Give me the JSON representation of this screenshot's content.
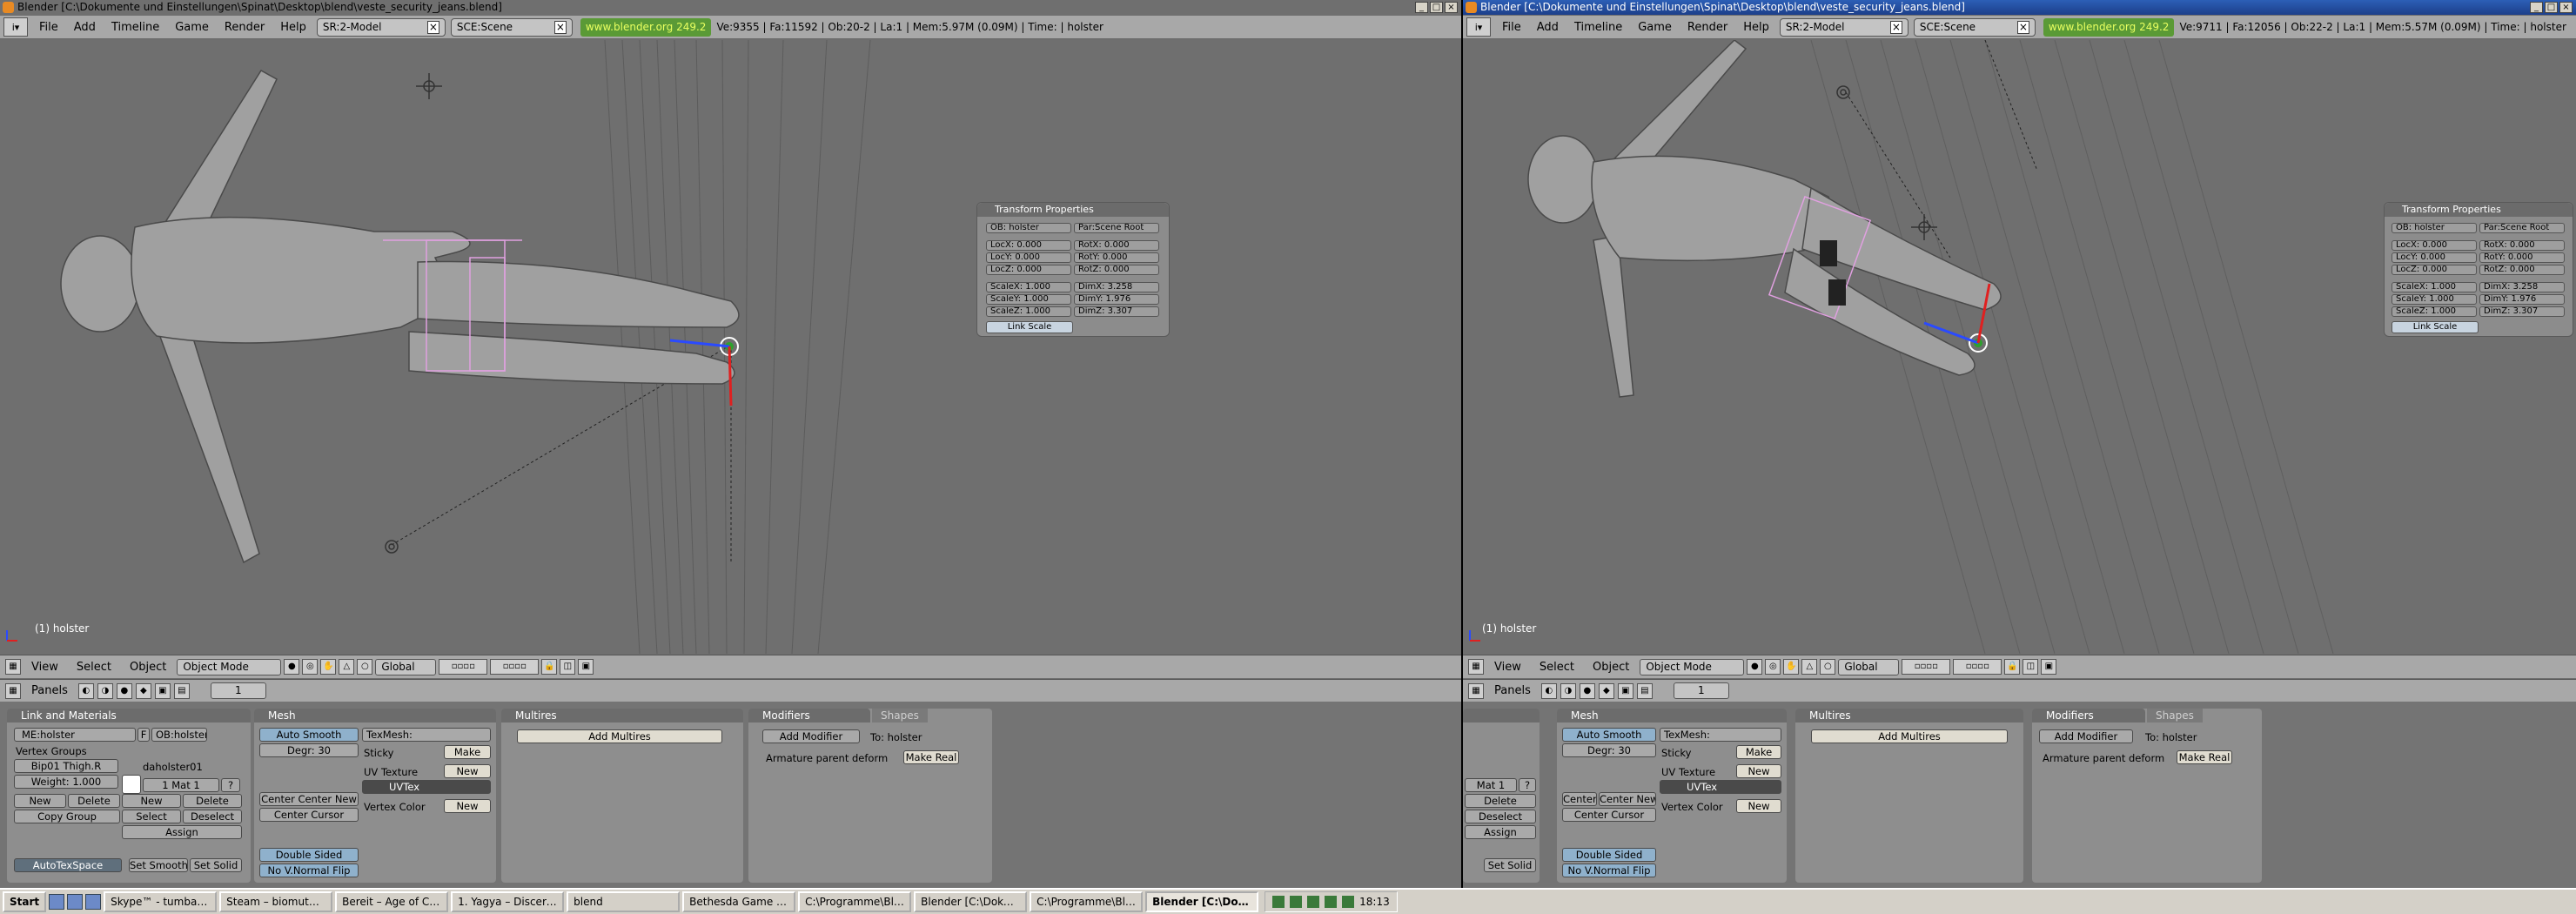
{
  "left": {
    "title": "Blender [C:\\Dokumente und Einstellungen\\Spinat\\Desktop\\blend\\veste_security_jeans.blend]",
    "menus": [
      "File",
      "Add",
      "Timeline",
      "Game",
      "Render",
      "Help"
    ],
    "screen": "SR:2-Model",
    "scene": "SCE:Scene",
    "url": "www.blender.org 249.2",
    "stats": "Ve:9355 | Fa:11592 | Ob:20-2 | La:1  | Mem:5.97M (0.09M)  | Time: | holster",
    "vp_label": "(1) holster",
    "vp_menus": [
      "View",
      "Select",
      "Object"
    ],
    "mode": "Object Mode",
    "orient": "Global",
    "panels_label": "Panels",
    "frame": "1"
  },
  "right": {
    "title": "Blender [C:\\Dokumente und Einstellungen\\Spinat\\Desktop\\blend\\veste_security_jeans.blend]",
    "menus": [
      "File",
      "Add",
      "Timeline",
      "Game",
      "Render",
      "Help"
    ],
    "screen": "SR:2-Model",
    "scene": "SCE:Scene",
    "url": "www.blender.org 249.2",
    "stats": "Ve:9711 | Fa:12056 | Ob:22-2 | La:1  | Mem:5.57M (0.09M)  | Time: | holster",
    "vp_label": "(1) holster",
    "vp_menus": [
      "View",
      "Select",
      "Object"
    ],
    "mode": "Object Mode",
    "orient": "Global",
    "panels_label": "Panels",
    "frame": "1"
  },
  "transform": {
    "title": "Transform Properties",
    "ob": "OB: holster",
    "par": "Par:Scene Root",
    "loc": [
      "LocX: 0.000",
      "LocY: 0.000",
      "LocZ: 0.000"
    ],
    "rot": [
      "RotX: 0.000",
      "RotY: 0.000",
      "RotZ: 0.000"
    ],
    "scale": [
      "ScaleX: 1.000",
      "ScaleY: 1.000",
      "ScaleZ: 1.000"
    ],
    "dim": [
      "DimX: 3.258",
      "DimY: 1.976",
      "DimZ: 3.307"
    ],
    "link_scale": "Link Scale"
  },
  "link_materials": {
    "title": "Link and Materials",
    "me": "ME:holster",
    "f": "F",
    "ob": "OB:holster",
    "vertex_groups": "Vertex Groups",
    "vgroup_name": "daholster01",
    "bone": "Bip01 Thigh.R",
    "weight": "Weight: 1.000",
    "mat": "1 Mat 1",
    "q": "?",
    "new": "New",
    "delete": "Delete",
    "copy_group": "Copy Group",
    "new2": "New",
    "delete2": "Delete",
    "select": "Select",
    "deselect": "Deselect",
    "assign": "Assign",
    "autotex": "AutoTexSpace",
    "set_smooth": "Set Smooth",
    "set_solid": "Set Solid"
  },
  "mesh": {
    "title": "Mesh",
    "auto_smooth": "Auto Smooth",
    "degr": "Degr: 30",
    "center_new": "Center Center New",
    "center_cursor": "Center Cursor",
    "double_sided": "Double Sided",
    "no_vnormal_flip": "No V.Normal Flip",
    "texmesh": "TexMesh:",
    "sticky": "Sticky",
    "make": "Make",
    "uv_texture": "UV Texture",
    "new": "New",
    "uvtex": "UVTex",
    "vertex_color": "Vertex Color",
    "new_vc": "New"
  },
  "multires": {
    "title": "Multires",
    "add": "Add Multires"
  },
  "modifiers": {
    "tab1": "Modifiers",
    "tab2": "Shapes",
    "add": "Add Modifier",
    "to": "To: holster",
    "armature": "Armature parent deform",
    "make_real": "Make Real"
  },
  "right_partial": {
    "mat": "Mat 1",
    "delete": "Delete",
    "deselect": "Deselect",
    "assign": "Assign",
    "set_solid": "Set Solid",
    "center": "Center",
    "center_new": "Center New",
    "center_cursor": "Center Cursor"
  },
  "taskbar": {
    "start": "Start",
    "items": [
      "Skype™ - tumbaja...",
      "Steam – biomutant",
      "Bereit – Age of Chi...",
      "1. Yagya – Discern...",
      "blend",
      "Bethesda Game St...",
      "C:\\Programme\\Ble...",
      "Blender [C:\\Dokum...",
      "C:\\Programme\\Ble...",
      "Blender [C:\\Dok..."
    ],
    "active_index": 9,
    "clock": "18:13"
  },
  "colors": {
    "viewport": "#6f6f6f",
    "panel": "#8e8e8e",
    "header": "#a8a8a8",
    "selected_wire": "#e0a0e0",
    "url_bg": "#5a9a36"
  }
}
